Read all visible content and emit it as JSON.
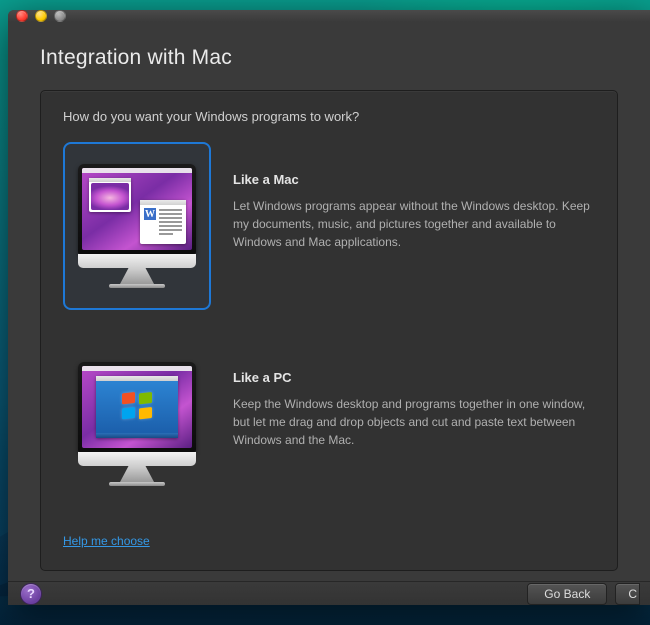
{
  "window": {
    "title": "Integration with Mac"
  },
  "panel": {
    "question": "How do you want your Windows programs to work?",
    "help_link": "Help me choose"
  },
  "options": {
    "mac": {
      "title": "Like a Mac",
      "desc": "Let Windows programs appear without the Windows desktop. Keep my documents, music, and pictures together and available to Windows and Mac applications.",
      "selected": true
    },
    "pc": {
      "title": "Like a PC",
      "desc": "Keep the Windows desktop and programs together in one window, but let me drag and drop objects and cut and paste text between Windows and the Mac.",
      "selected": false
    }
  },
  "footer": {
    "help_symbol": "?",
    "go_back": "Go Back",
    "continue_fragment": "C"
  }
}
